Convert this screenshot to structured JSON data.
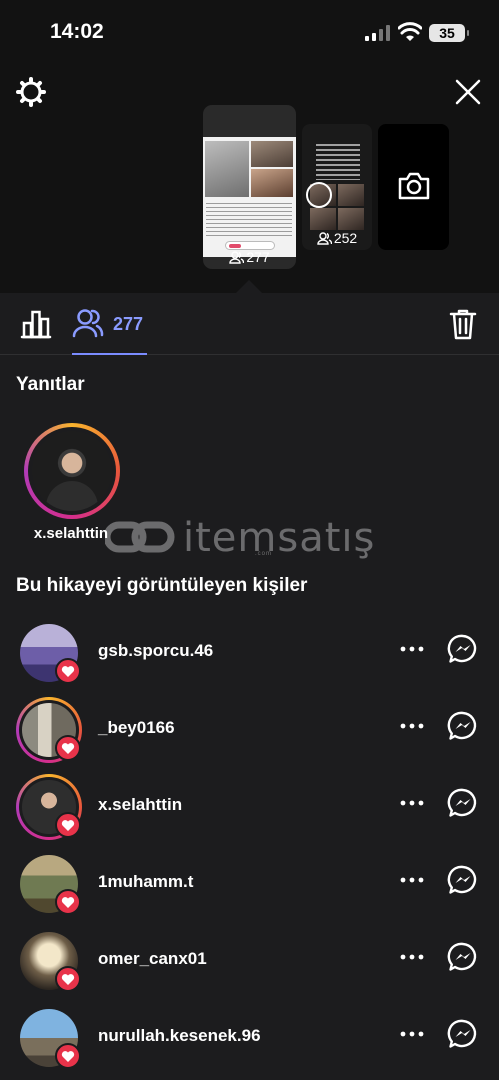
{
  "status_bar": {
    "time": "14:02",
    "battery": "35"
  },
  "stories": [
    {
      "viewers": "277",
      "selected": true
    },
    {
      "viewers": "252",
      "selected": false
    }
  ],
  "tabs": {
    "viewers_count": "277"
  },
  "replies": {
    "title": "Yanıtlar",
    "items": [
      {
        "username": "x.selahttin"
      }
    ]
  },
  "watermark": {
    "brand": "itemsatış",
    "sub": ".com"
  },
  "viewers": {
    "title": "Bu hikayeyi görüntüleyen kişiler",
    "items": [
      {
        "username": "gsb.sporcu.46",
        "liked": true,
        "story_ring": false
      },
      {
        "username": "_bey0166",
        "liked": true,
        "story_ring": true
      },
      {
        "username": "x.selahttin",
        "liked": true,
        "story_ring": true
      },
      {
        "username": "1muhamm.t",
        "liked": true,
        "story_ring": false
      },
      {
        "username": "omer_canx01",
        "liked": true,
        "story_ring": false
      },
      {
        "username": "nurullah.kesenek.96",
        "liked": true,
        "story_ring": false
      }
    ]
  },
  "colors": {
    "accent": "#8a9bff",
    "heart": "#e8334a",
    "background": "#1c1c1e"
  }
}
